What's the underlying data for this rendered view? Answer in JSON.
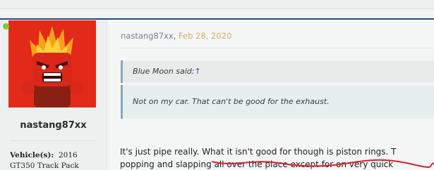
{
  "post": {
    "author": "nastang87xx",
    "date": "Feb 28, 2020",
    "online_status_color": "#7ec93a",
    "quote": {
      "attribution": "Blue Moon said:",
      "arrow": "↑",
      "text": "Not on my car. That can't be good for the exhaust."
    },
    "message_line_1_a": "It's just pipe really. ",
    "message_line_1_b": "What it isn't good for though is piston rings. T",
    "message_line_2": "popping and slapping all over the place except for on very quick"
  },
  "profile": {
    "username": "nastang87xx",
    "vehicle_label": "Vehicle(s):",
    "vehicle_value_1": "2016",
    "vehicle_value_2": "GT350 Track Pack",
    "avatar_icon": "angry-flame-character-icon"
  },
  "colors": {
    "accent_rule": "#2a4a7a",
    "annotation_red": "#d8202a"
  }
}
